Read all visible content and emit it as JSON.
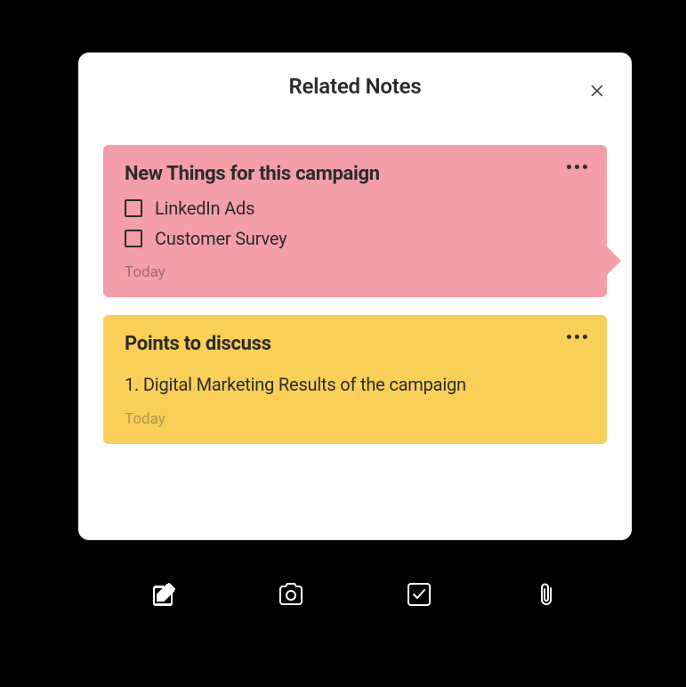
{
  "header": {
    "title": "Related Notes"
  },
  "notes": [
    {
      "title": "New Things for this campaign",
      "color": "pink",
      "checklist": [
        {
          "label": "LinkedIn Ads"
        },
        {
          "label": "Customer Survey"
        }
      ],
      "date": "Today"
    },
    {
      "title": "Points to discuss",
      "color": "yellow",
      "body": "1. Digital Marketing Results of the campaign",
      "date": "Today"
    }
  ],
  "bottomBar": {
    "compose": "compose",
    "camera": "camera",
    "checkbox": "checkbox",
    "attachment": "attachment"
  }
}
